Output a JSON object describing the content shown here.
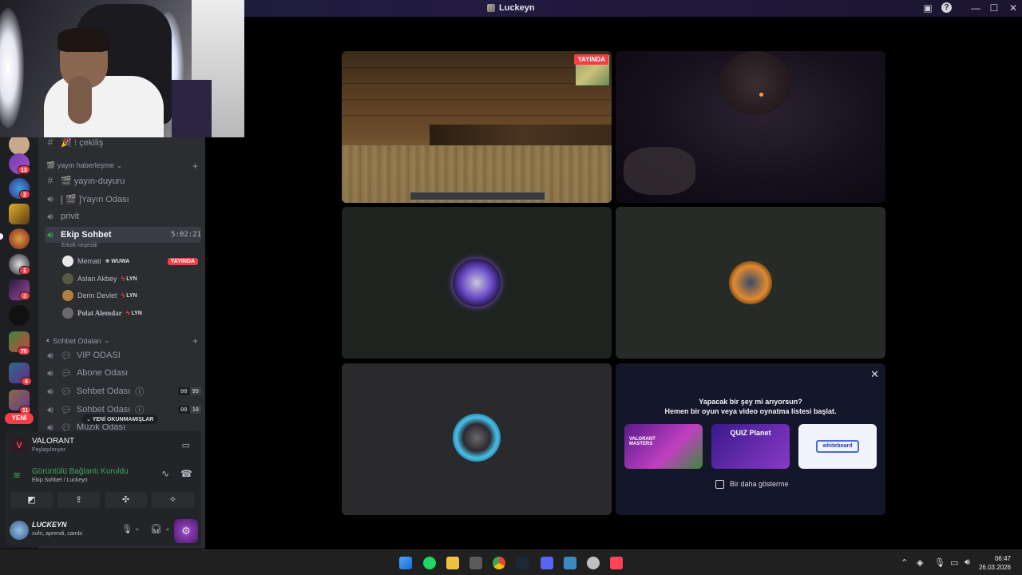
{
  "window": {
    "title": "Luckeyn"
  },
  "sidebar": {
    "channels": [
      {
        "name": "🎉 ⁝ çekiliş"
      },
      {
        "name": "🎬 yayın-duyuru"
      },
      {
        "name": "[ 🎬 ]Yayın Odası"
      },
      {
        "name": "privit"
      }
    ],
    "category_stream": "🎬 yayın haberleşme",
    "active_voice": {
      "name": "Ekip Sohbet",
      "timer": "5:02:21",
      "subtitle": "Erkek neşesiiii"
    },
    "voice_users": [
      {
        "name": "Memati",
        "tag": "WUWA",
        "live": "YAYINDA"
      },
      {
        "name": "Aslan Akbey",
        "tag": "LYN"
      },
      {
        "name": "Derin Devlet",
        "tag": "LYN"
      },
      {
        "name": "Polat Alemdar",
        "tag": "LYN"
      }
    ],
    "category_chat": "Sohbet Odaları",
    "chat_rooms": [
      {
        "name": "VIP ODASI"
      },
      {
        "name": "Abone Odası"
      },
      {
        "name": "Sohbet Odası",
        "count_a": "00",
        "count_b": "99"
      },
      {
        "name": "Sohbet Odası",
        "count_a": "00",
        "count_b": "10"
      },
      {
        "name": "Müzik Odası"
      }
    ],
    "unread_pill": "YENİ OKUNMAMIŞLAR",
    "new_pill": "YENİ",
    "server_badges": [
      "13",
      "2",
      "1",
      "3",
      "70",
      "4",
      "11"
    ]
  },
  "activity_panel": {
    "game": "VALORANT",
    "status": "Paylaşılmıyor"
  },
  "voice_panel": {
    "status": "Görüntülü Bağlantı Kuruldu",
    "location": "Ekip Sohbet / Luckeyn"
  },
  "user_panel": {
    "name": "LUCKEYN",
    "status": "sufri, aprendi, cambi"
  },
  "stage": {
    "live_label": "YAYINDA",
    "activity_prompt": "Yapacak bir şey mi arıyorsun?",
    "activity_sub": "Hemen bir oyun veya video oynatma listesi başlat.",
    "cards": [
      {
        "name": "VALORANT MASTERS",
        "color": "#7a2fa0"
      },
      {
        "name": "QUIZ Planet",
        "color": "#5b2da8"
      },
      {
        "name": "whiteboard",
        "color": "#f3f3fb"
      }
    ],
    "dont_show": "Bir daha gösterme"
  },
  "taskbar": {
    "time": "06:47",
    "date": "26.03.2026"
  },
  "colors": {
    "accent": "#5865f2",
    "danger": "#f23f43",
    "sidebar": "#2b2d31"
  }
}
